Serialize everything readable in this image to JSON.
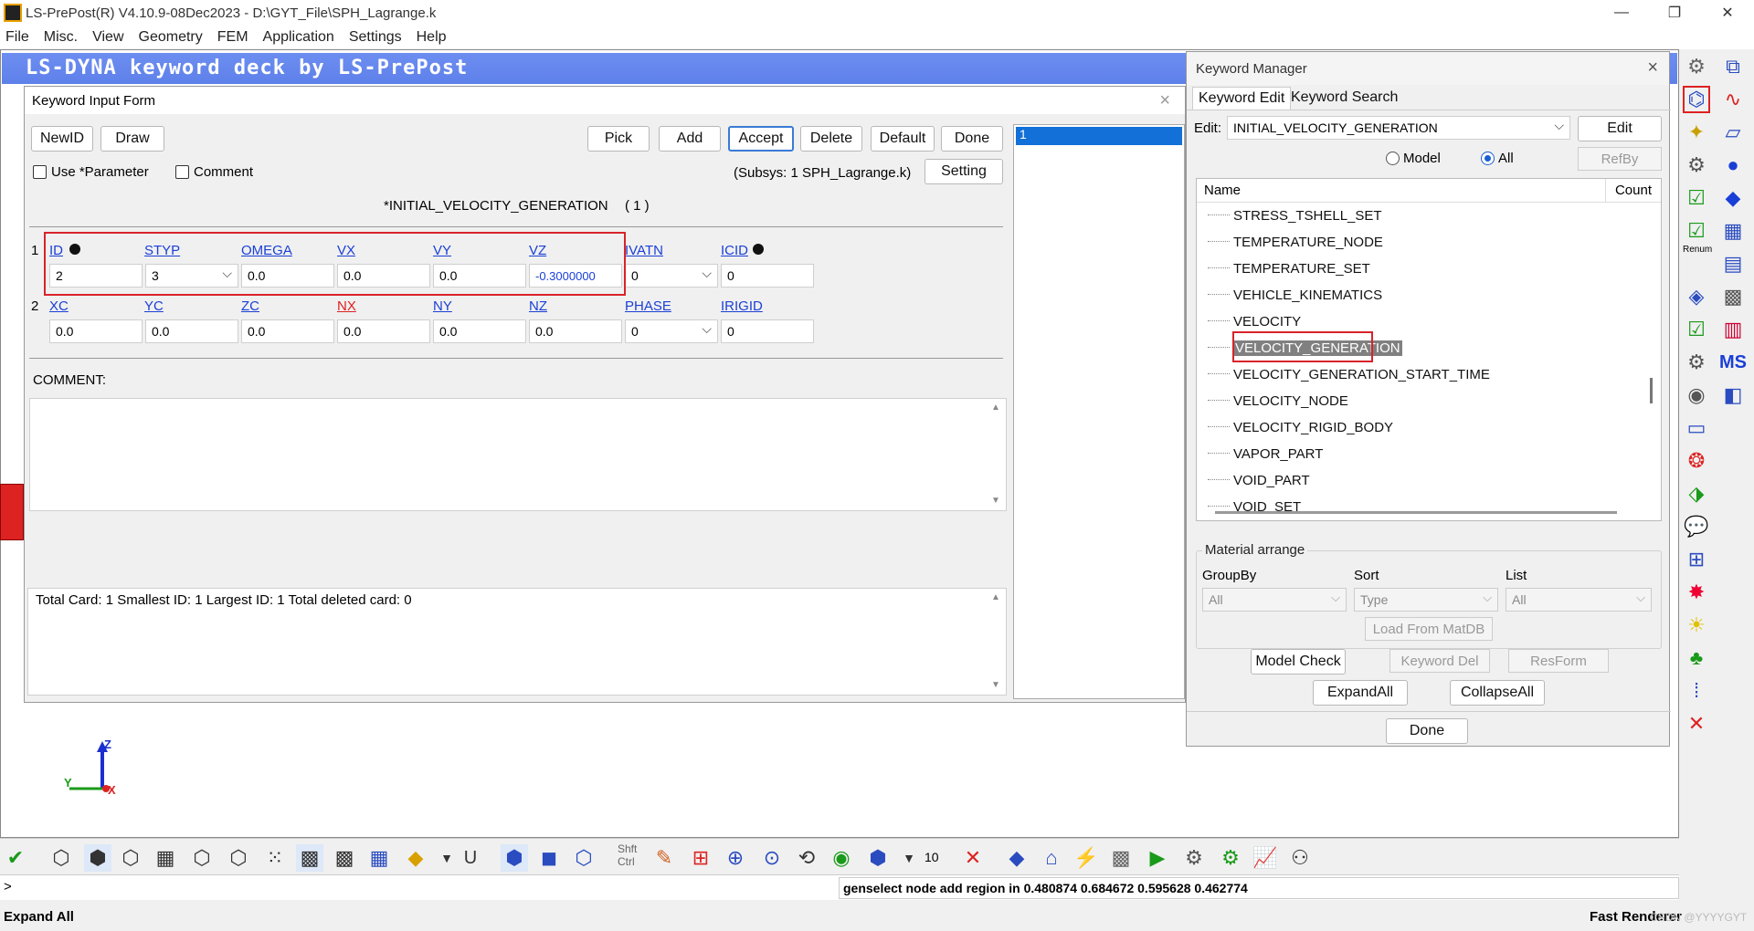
{
  "window": {
    "title": "LS-PrePost(R) V4.10.9-08Dec2023 - D:\\GYT_File\\SPH_Lagrange.k",
    "min": "—",
    "max": "❐",
    "close": "✕"
  },
  "menu": [
    "File",
    "Misc.",
    "View",
    "Geometry",
    "FEM",
    "Application",
    "Settings",
    "Help"
  ],
  "banner": "LS-DYNA keyword deck by LS-PrePost",
  "form": {
    "title": "Keyword Input Form",
    "close": "×",
    "buttons": {
      "newid": "NewID",
      "draw": "Draw",
      "pick": "Pick",
      "add": "Add",
      "accept": "Accept",
      "delete": "Delete",
      "default": "Default",
      "done": "Done",
      "setting": "Setting"
    },
    "use_param": "Use *Parameter",
    "comment_chk": "Comment",
    "subsys": "(Subsys: 1 SPH_Lagrange.k)",
    "keyword": "*INITIAL_VELOCITY_GENERATION",
    "count": "( 1 )",
    "card1": {
      "num": "1",
      "labels": [
        "ID",
        "STYP",
        "OMEGA",
        "VX",
        "VY",
        "VZ",
        "IVATN",
        "ICID"
      ],
      "values": [
        "2",
        "3",
        "0.0",
        "0.0",
        "0.0",
        "-0.3000000",
        "0",
        "0"
      ]
    },
    "card2": {
      "num": "2",
      "labels": [
        "XC",
        "YC",
        "ZC",
        "NX",
        "NY",
        "NZ",
        "PHASE",
        "IRIGID"
      ],
      "values": [
        "0.0",
        "0.0",
        "0.0",
        "0.0",
        "0.0",
        "0.0",
        "0",
        "0"
      ]
    },
    "comment_label": "COMMENT:",
    "summary": "Total Card: 1    Smallest ID: 1    Largest ID: 1    Total deleted card:  0",
    "id_list": [
      "1"
    ]
  },
  "km": {
    "title": "Keyword Manager",
    "close": "×",
    "tab_edit": "Keyword Edit",
    "tab_search": "Keyword Search",
    "edit_label": "Edit:",
    "edit_value": "INITIAL_VELOCITY_GENERATION",
    "edit_btn": "Edit",
    "radio_model": "Model",
    "radio_all": "All",
    "refby": "RefBy",
    "col_name": "Name",
    "col_count": "Count",
    "items": [
      "STRESS_TSHELL_SET",
      "TEMPERATURE_NODE",
      "TEMPERATURE_SET",
      "VEHICLE_KINEMATICS",
      "VELOCITY",
      "VELOCITY_GENERATION",
      "VELOCITY_GENERATION_START_TIME",
      "VELOCITY_NODE",
      "VELOCITY_RIGID_BODY",
      "VAPOR_PART",
      "VOID_PART",
      "VOID_SET"
    ],
    "mat_title": "Material arrange",
    "groupby": "GroupBy",
    "sort": "Sort",
    "list": "List",
    "groupby_val": "All",
    "sort_val": "Type",
    "list_val": "All",
    "load_matdb": "Load From MatDB",
    "model_check": "Model Check",
    "keyword_del": "Keyword Del",
    "resform": "ResForm",
    "expandall": "ExpandAll",
    "collapseall": "CollapseAll",
    "done": "Done"
  },
  "cmd": {
    "prompt": ">",
    "output": "genselect node add region in 0.480874 0.684672 0.595628 0.462774",
    "ten": "10",
    "shift": "Shft",
    "ctrl": "Ctrl",
    "u": "U"
  },
  "status": {
    "left": "Expand All",
    "right": "Fast Renderer",
    "watermark": "CSDN @YYYYGYT"
  },
  "side_labels": {
    "renum": "Renum",
    "ms": "MS"
  },
  "axis": {
    "z": "Z",
    "y": "Y",
    "x": "X"
  }
}
